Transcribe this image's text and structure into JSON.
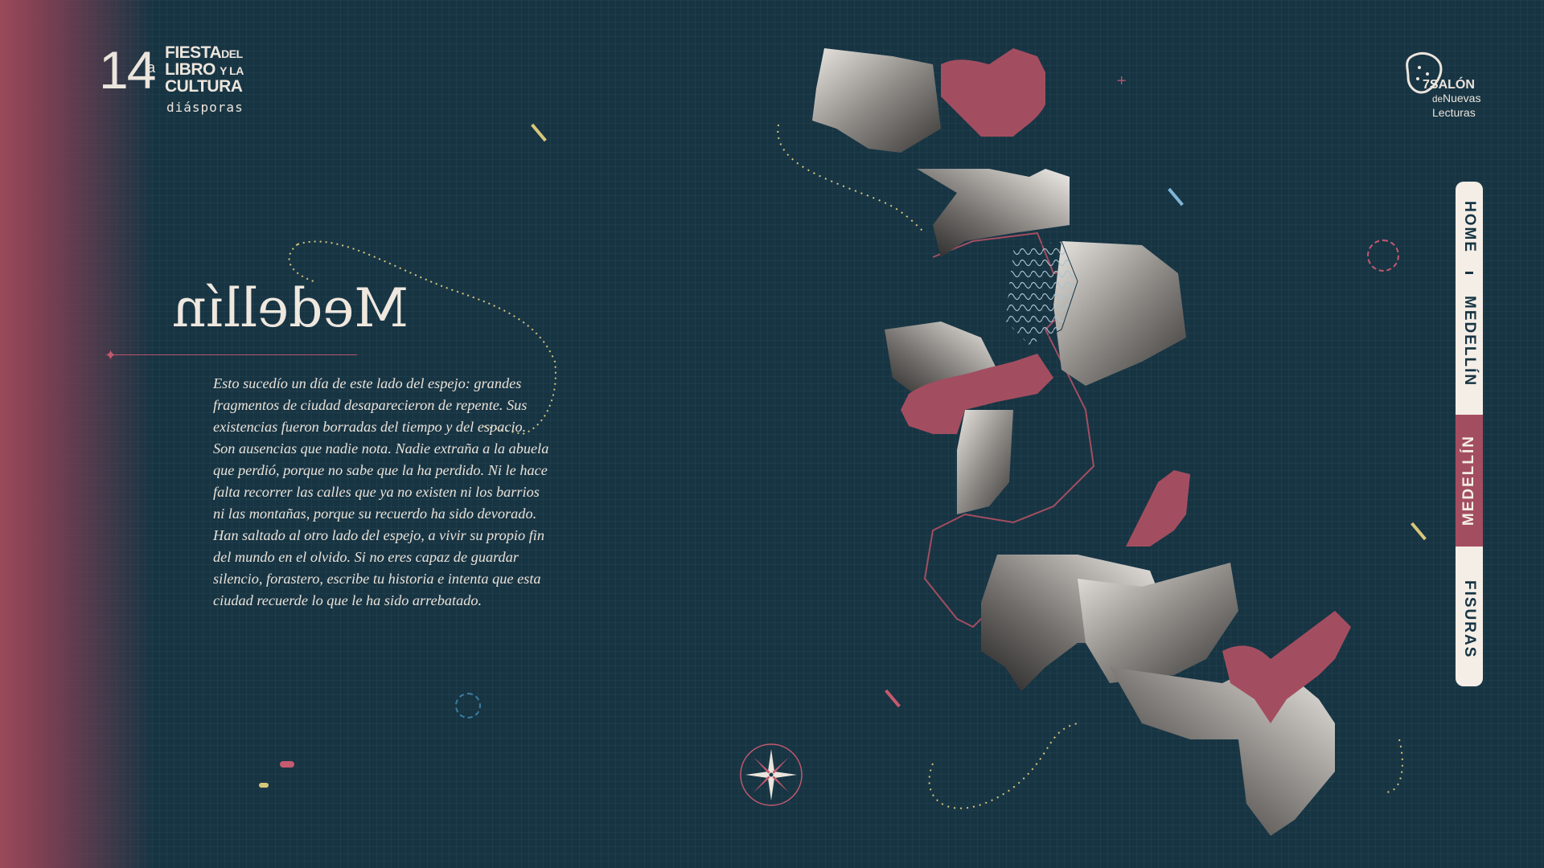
{
  "logo": {
    "number": "14",
    "suffix": "a",
    "line1_big": "FIESTA",
    "line1_small": "DEL",
    "line2_big": "LIBRO",
    "line2_small": "Y LA",
    "line3_big": "CULTURA",
    "subtitle": "diásporas"
  },
  "page": {
    "title": "Medellín",
    "body": "Esto sucedío  un día de este lado del espejo: grandes fragmentos de ciudad desaparecieron de repente. Sus existencias fueron borradas del tiempo y del espacio. Son ausencias que nadie nota. Nadie extraña a la abuela que perdió, porque no sabe que la ha perdido. Ni le hace falta recorrer las calles que ya no existen ni los barrios ni las montañas, porque su recuerdo ha sido devorado. Han saltado al otro lado del espejo, a vivir su propio fin del mundo en el olvido. Si no eres capaz de guardar silencio, forastero, escribe tu historia e intenta que esta ciudad recuerde lo que le ha sido arrebatado."
  },
  "salon_logo": {
    "num": "7",
    "line1": "SALÓN",
    "line2_small": "de",
    "line2": "Nuevas",
    "line3": "Lecturas"
  },
  "nav": {
    "items": [
      {
        "label": "HOME",
        "active": false
      },
      {
        "label": "MEDELLÍN",
        "active": false
      },
      {
        "label": "MEDELLÍN",
        "active": true
      },
      {
        "label": "FISURAS",
        "active": false
      }
    ]
  },
  "icons": {
    "compass": "compass-rose-icon",
    "logo_mark": "sparkle-icon",
    "salon_mark": "leopard-icon"
  },
  "colors": {
    "background": "#173443",
    "accent": "#a34e60",
    "text": "#ece5dc",
    "yellow": "#d8c77a",
    "blue": "#7fb5d5"
  }
}
